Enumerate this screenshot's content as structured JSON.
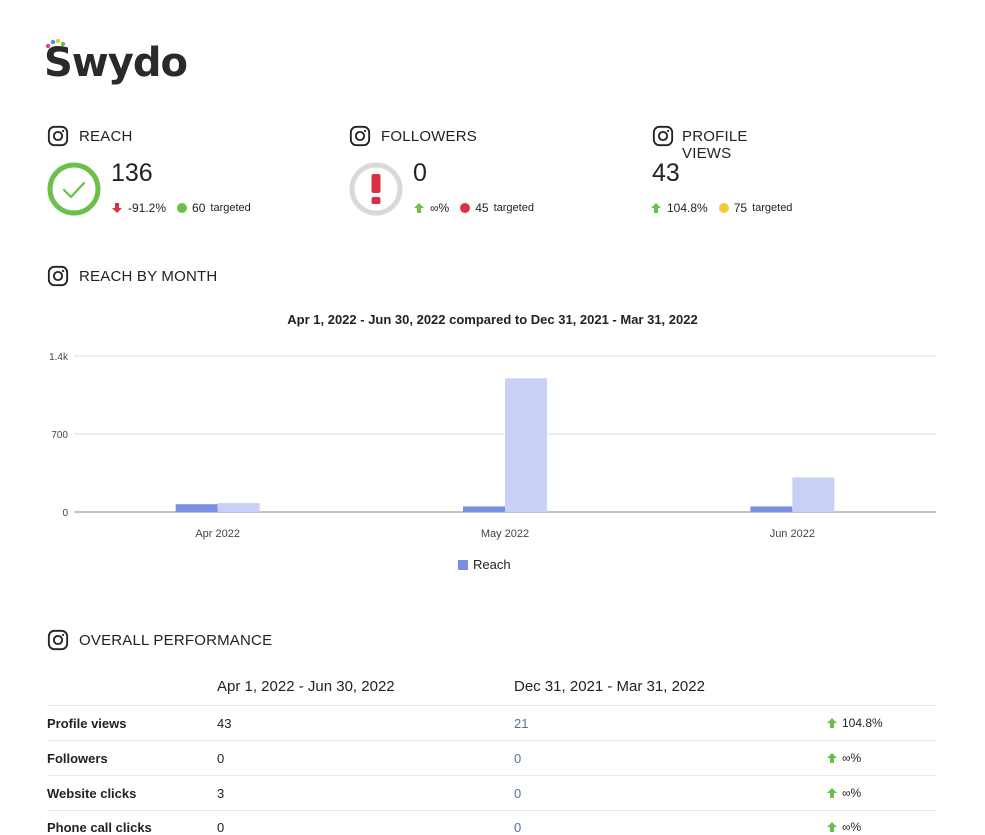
{
  "brand": {
    "name": "Swydo"
  },
  "kpis": [
    {
      "title": "REACH",
      "value": "136",
      "change": "-91.2%",
      "direction": "down",
      "target_text": "60",
      "target_suffix": "targeted",
      "status": "check",
      "status_color": "#6cc04a",
      "target_dot_color": "#6cc04a"
    },
    {
      "title": "FOLLOWERS",
      "value": "0",
      "change": "∞%",
      "direction": "up",
      "target_text": "45",
      "target_suffix": "targeted",
      "status": "alert",
      "status_color": "#d9d9d9",
      "target_dot_color": "#d93045"
    },
    {
      "title": "PROFILE VIEWS",
      "value": "43",
      "change": "104.8%",
      "direction": "up",
      "target_text": "75",
      "target_suffix": "targeted",
      "status": "none",
      "target_dot_color": "#f5cc2e"
    }
  ],
  "reach_by_month": {
    "title": "REACH BY MONTH",
    "chart_title": "Apr 1, 2022 - Jun 30, 2022 compared to Dec 31, 2021 - Mar 31, 2022"
  },
  "chart_data": {
    "type": "bar",
    "categories": [
      "Apr 2022",
      "May 2022",
      "Jun 2022"
    ],
    "series": [
      {
        "name": "Reach",
        "values": [
          70,
          50,
          50
        ],
        "color": "#7b8fe0"
      },
      {
        "values": [
          80,
          1200,
          310
        ],
        "color": "#c9d0f7"
      }
    ],
    "ylim": [
      0,
      1400
    ],
    "yticks": [
      {
        "value": 0,
        "label": "0"
      },
      {
        "value": 700,
        "label": "700"
      },
      {
        "value": 1400,
        "label": "1.4k"
      }
    ],
    "legend": "bottom-center",
    "grid": true
  },
  "performance": {
    "title": "OVERALL PERFORMANCE",
    "col_current": "Apr 1, 2022 - Jun 30, 2022",
    "col_previous": "Dec 31, 2021 - Mar 31, 2022",
    "rows": [
      {
        "label": "Profile views",
        "current": "43",
        "previous": "21",
        "change": "104.8%"
      },
      {
        "label": "Followers",
        "current": "0",
        "previous": "0",
        "change": "∞%"
      },
      {
        "label": "Website clicks",
        "current": "3",
        "previous": "0",
        "change": "∞%"
      },
      {
        "label": "Phone call clicks",
        "current": "0",
        "previous": "0",
        "change": "∞%"
      }
    ]
  },
  "colors": {
    "up": "#6cc04a",
    "down": "#d93045",
    "accent": "#7b8fe0"
  }
}
